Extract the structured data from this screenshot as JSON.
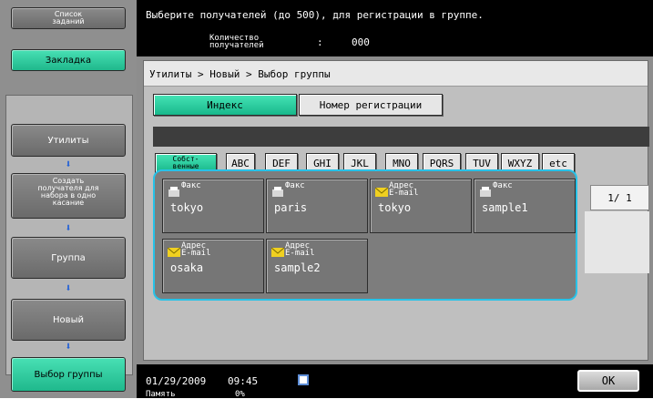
{
  "sidebar": {
    "job_list": "Список\nзаданий",
    "bookmark": "Закладка",
    "utilities": "Утилиты",
    "create_onetouch": "Создать\nполучателя для\nнабора в одно\nкасание",
    "group": "Группа",
    "new": "Новый",
    "select_group": "Выбор группы"
  },
  "header": {
    "message": "Выберите получателей (до 500), для регистрации в группе.",
    "count_label": "Количество\nполучателей",
    "count_sep": ":",
    "count_value": "000"
  },
  "breadcrumb": "Утилиты > Новый > Выбор группы",
  "tabs": [
    {
      "label": "Индекс",
      "active": true
    },
    {
      "label": "Номер регистрации",
      "active": false
    }
  ],
  "index_tabs": [
    {
      "label": "Собст-\nвенные",
      "active": true
    },
    {
      "label": "ABC"
    },
    {
      "label": "DEF"
    },
    {
      "label": "GHI"
    },
    {
      "label": "JKL"
    },
    {
      "label": "MNO"
    },
    {
      "label": "PQRS"
    },
    {
      "label": "TUV"
    },
    {
      "label": "WXYZ"
    },
    {
      "label": "etc"
    }
  ],
  "destinations": [
    {
      "type": "Факс",
      "icon": "fax-icon",
      "name": "tokyo"
    },
    {
      "type": "Факс",
      "icon": "fax-icon",
      "name": "paris"
    },
    {
      "type": "Адрес\nE-mail",
      "icon": "email-icon",
      "name": "tokyo"
    },
    {
      "type": "Факс",
      "icon": "fax-icon",
      "name": "sample1"
    },
    {
      "type": "Адрес\nE-mail",
      "icon": "email-icon",
      "name": "osaka"
    },
    {
      "type": "Адрес\nE-mail",
      "icon": "email-icon",
      "name": "sample2"
    }
  ],
  "pager": "1/  1",
  "status": {
    "date": "01/29/2009",
    "time": "09:45",
    "memory_label": "Память",
    "memory_value": "0%"
  },
  "ok_label": "OK",
  "colors": {
    "accent_green": "#2ccf9f",
    "highlight_cyan": "#27c2e8",
    "arrow_blue": "#1f5fd8"
  }
}
